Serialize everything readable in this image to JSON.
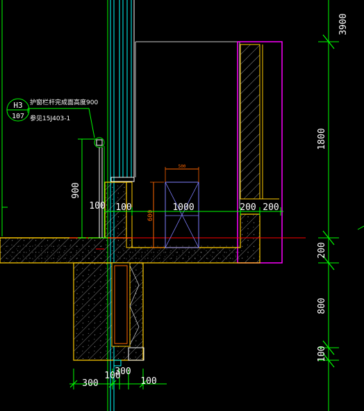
{
  "colors": {
    "background": "#000000",
    "dimension_line": "#00ff00",
    "concrete": "#ffcc00",
    "glazing": "#00ffff",
    "wall_outline": "#ff00ff",
    "cut_line": "#ff0000",
    "window_box": "#8080ff",
    "window_dim": "#ff6600",
    "text": "#ffffff"
  },
  "callout": {
    "ref_top": "H3",
    "ref_bottom": "107",
    "note_line1": "护窗栏杆完成面高度900",
    "note_line2": "参见15J403-1"
  },
  "dimensions": {
    "right_3900": "3900",
    "right_1800": "1800",
    "right_200": "200",
    "right_800": "800",
    "right_100": "100",
    "left_900": "900",
    "left_100": "100",
    "floor_100": "100",
    "floor_1000": "1000",
    "floor_200a": "200",
    "floor_200b": "200",
    "bottom_300": "300",
    "bottom_100a": "100",
    "bottom_300b": "300",
    "bottom_100b": "100",
    "window_width": "500",
    "window_height": "600"
  }
}
